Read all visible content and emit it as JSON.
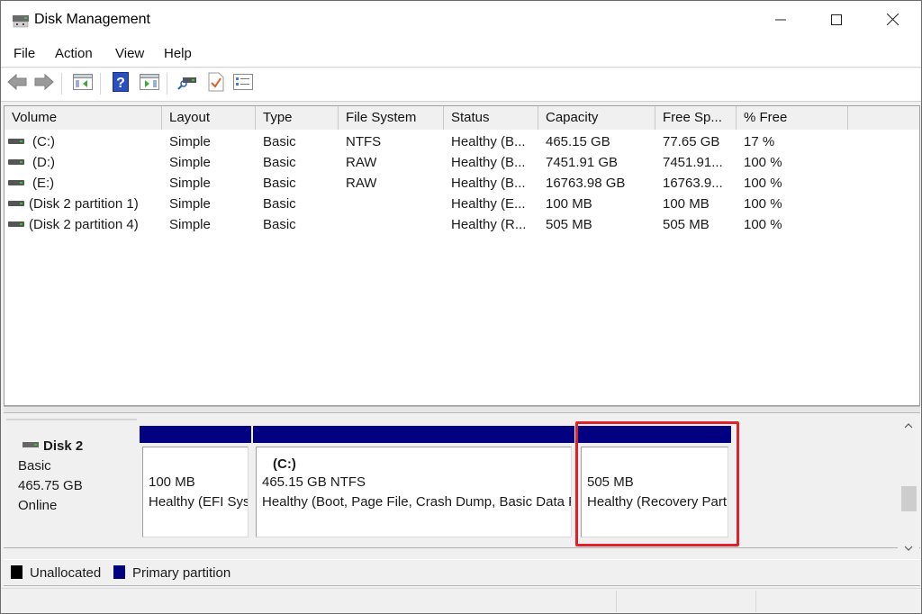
{
  "window": {
    "title": "Disk Management",
    "icon": "disk-management-icon",
    "controls": {
      "minimize": "minimize-icon",
      "maximize": "maximize-icon",
      "close": "close-icon"
    }
  },
  "menu": {
    "items": [
      "File",
      "Action",
      "View",
      "Help"
    ]
  },
  "toolbar": {
    "buttons": [
      {
        "name": "back",
        "icon": "back-arrow-icon"
      },
      {
        "name": "forward",
        "icon": "forward-arrow-icon"
      },
      {
        "name": "show-hide-console-tree",
        "icon": "console-tree-icon"
      },
      {
        "name": "help",
        "icon": "help-icon"
      },
      {
        "name": "show-hide-action-pane",
        "icon": "action-pane-icon"
      },
      {
        "name": "connect-disk",
        "icon": "disk-connect-icon"
      },
      {
        "name": "properties",
        "icon": "checklist-doc-icon"
      },
      {
        "name": "settings-list",
        "icon": "list-settings-icon"
      }
    ]
  },
  "volume_list": {
    "columns": [
      "Volume",
      "Layout",
      "Type",
      "File System",
      "Status",
      "Capacity",
      "Free Sp...",
      "% Free"
    ],
    "rows": [
      {
        "volume": "(C:)",
        "layout": "Simple",
        "type": "Basic",
        "fs": "NTFS",
        "status": "Healthy (B...",
        "capacity": "465.15 GB",
        "free": "77.65 GB",
        "pct_free": "17 %"
      },
      {
        "volume": "(D:)",
        "layout": "Simple",
        "type": "Basic",
        "fs": "RAW",
        "status": "Healthy (B...",
        "capacity": "7451.91 GB",
        "free": "7451.91...",
        "pct_free": "100 %"
      },
      {
        "volume": "(E:)",
        "layout": "Simple",
        "type": "Basic",
        "fs": "RAW",
        "status": "Healthy (B...",
        "capacity": "16763.98 GB",
        "free": "16763.9...",
        "pct_free": "100 %"
      },
      {
        "volume": "(Disk 2 partition 1)",
        "layout": "Simple",
        "type": "Basic",
        "fs": "",
        "status": "Healthy (E...",
        "capacity": "100 MB",
        "free": "100 MB",
        "pct_free": "100 %"
      },
      {
        "volume": "(Disk 2 partition 4)",
        "layout": "Simple",
        "type": "Basic",
        "fs": "",
        "status": "Healthy (R...",
        "capacity": "505 MB",
        "free": "505 MB",
        "pct_free": "100 %"
      }
    ]
  },
  "disk": {
    "name": "Disk 2",
    "type": "Basic",
    "size": "465.75 GB",
    "state": "Online",
    "partitions": [
      {
        "label": "",
        "size": "100 MB",
        "status": "Healthy (EFI System Partition)",
        "highlighted": false
      },
      {
        "label": "(C:)",
        "size": "465.15 GB NTFS",
        "status": "Healthy (Boot, Page File, Crash Dump, Basic Data Partition)",
        "highlighted": false
      },
      {
        "label": "",
        "size": "505 MB",
        "status": "Healthy (Recovery Partition)",
        "highlighted": true
      }
    ]
  },
  "legend": {
    "items": [
      {
        "label": "Unallocated",
        "color": "#000000"
      },
      {
        "label": "Primary partition",
        "color": "#000080"
      }
    ]
  },
  "colors": {
    "primary_partition": "#000080",
    "highlight": "#e0202a"
  }
}
